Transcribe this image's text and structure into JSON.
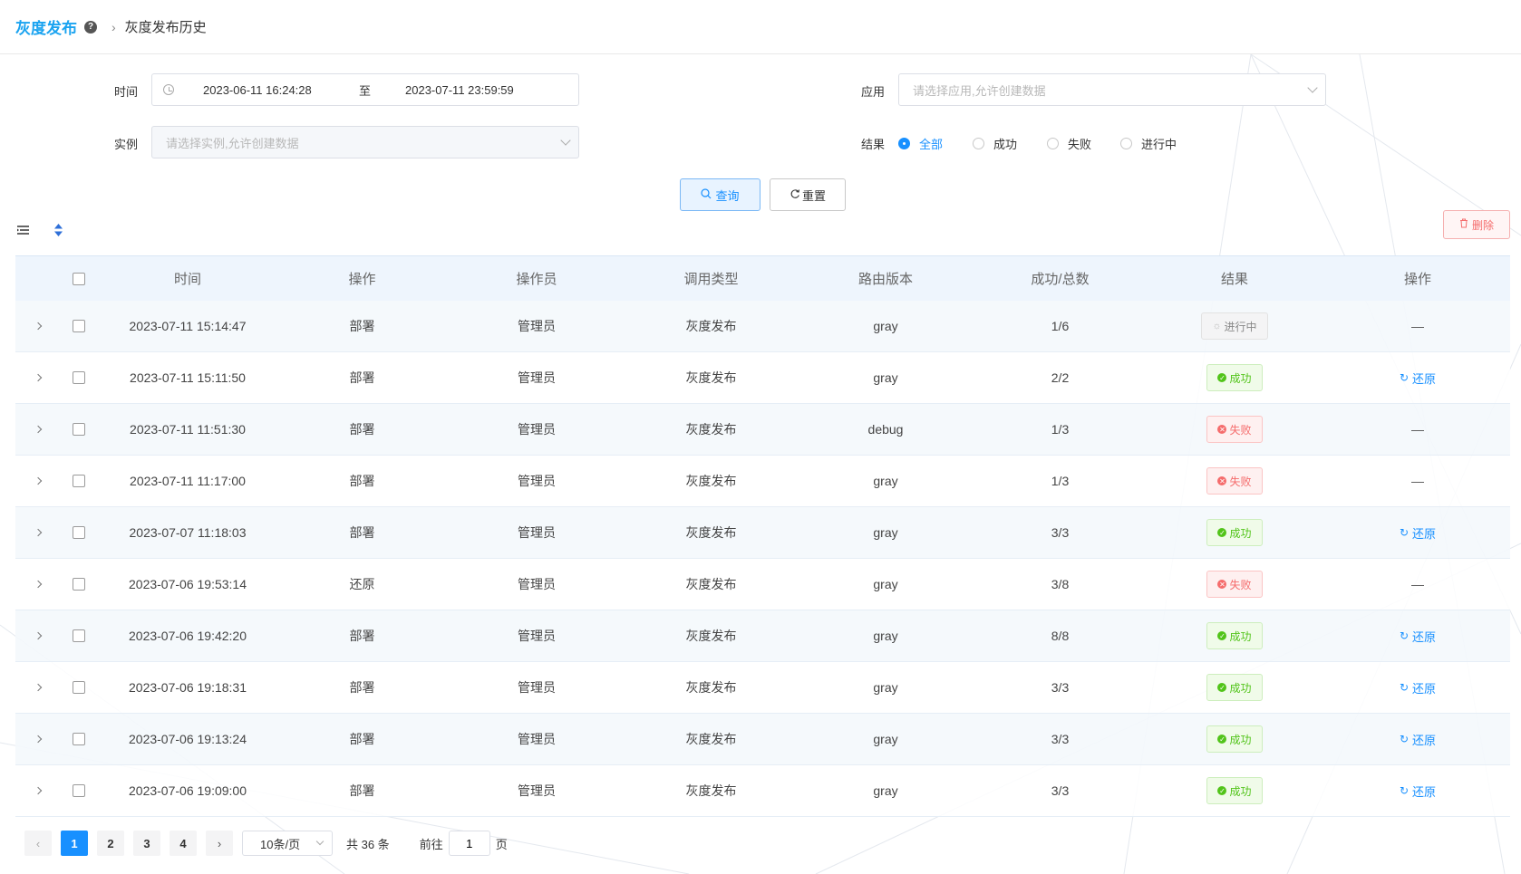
{
  "header": {
    "title": "灰度发布",
    "help_icon": "question-circle-icon",
    "breadcrumb_current": "灰度发布历史"
  },
  "filters": {
    "time_label": "时间",
    "time_start": "2023-06-11 16:24:28",
    "time_sep": "至",
    "time_end": "2023-07-11 23:59:59",
    "app_label": "应用",
    "app_placeholder": "请选择应用,允许创建数据",
    "instance_label": "实例",
    "instance_placeholder": "请选择实例,允许创建数据",
    "result_label": "结果",
    "result_options": [
      "全部",
      "成功",
      "失败",
      "进行中"
    ],
    "result_selected": "全部"
  },
  "actions": {
    "query": "查询",
    "reset": "重置",
    "delete": "删除"
  },
  "table": {
    "headers": [
      "时间",
      "操作",
      "操作员",
      "调用类型",
      "路由版本",
      "成功/总数",
      "结果",
      "操作"
    ],
    "restore_label": "还原",
    "rows": [
      {
        "time": "2023-07-11 15:14:47",
        "op": "部署",
        "operator": "管理员",
        "type": "灰度发布",
        "version": "gray",
        "ratio": "1/6",
        "result": "进行中",
        "status": "running",
        "action": "—"
      },
      {
        "time": "2023-07-11 15:11:50",
        "op": "部署",
        "operator": "管理员",
        "type": "灰度发布",
        "version": "gray",
        "ratio": "2/2",
        "result": "成功",
        "status": "success",
        "action": "还原"
      },
      {
        "time": "2023-07-11 11:51:30",
        "op": "部署",
        "operator": "管理员",
        "type": "灰度发布",
        "version": "debug",
        "ratio": "1/3",
        "result": "失败",
        "status": "fail",
        "action": "—"
      },
      {
        "time": "2023-07-11 11:17:00",
        "op": "部署",
        "operator": "管理员",
        "type": "灰度发布",
        "version": "gray",
        "ratio": "1/3",
        "result": "失败",
        "status": "fail",
        "action": "—"
      },
      {
        "time": "2023-07-07 11:18:03",
        "op": "部署",
        "operator": "管理员",
        "type": "灰度发布",
        "version": "gray",
        "ratio": "3/3",
        "result": "成功",
        "status": "success",
        "action": "还原"
      },
      {
        "time": "2023-07-06 19:53:14",
        "op": "还原",
        "operator": "管理员",
        "type": "灰度发布",
        "version": "gray",
        "ratio": "3/8",
        "result": "失败",
        "status": "fail",
        "action": "—"
      },
      {
        "time": "2023-07-06 19:42:20",
        "op": "部署",
        "operator": "管理员",
        "type": "灰度发布",
        "version": "gray",
        "ratio": "8/8",
        "result": "成功",
        "status": "success",
        "action": "还原"
      },
      {
        "time": "2023-07-06 19:18:31",
        "op": "部署",
        "operator": "管理员",
        "type": "灰度发布",
        "version": "gray",
        "ratio": "3/3",
        "result": "成功",
        "status": "success",
        "action": "还原"
      },
      {
        "time": "2023-07-06 19:13:24",
        "op": "部署",
        "operator": "管理员",
        "type": "灰度发布",
        "version": "gray",
        "ratio": "3/3",
        "result": "成功",
        "status": "success",
        "action": "还原"
      },
      {
        "time": "2023-07-06 19:09:00",
        "op": "部署",
        "operator": "管理员",
        "type": "灰度发布",
        "version": "gray",
        "ratio": "3/3",
        "result": "成功",
        "status": "success",
        "action": "还原"
      }
    ]
  },
  "pagination": {
    "pages": [
      "1",
      "2",
      "3",
      "4"
    ],
    "current": "1",
    "page_size": "10条/页",
    "total": "共 36 条",
    "goto_label": "前往",
    "goto_value": "1",
    "goto_suffix": "页"
  },
  "colors": {
    "accent": "#1890ff",
    "success": "#52c41a",
    "fail": "#f56c6c",
    "title": "#1aa3f0"
  }
}
